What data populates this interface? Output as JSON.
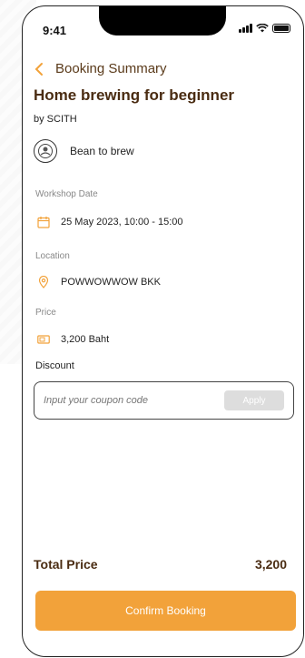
{
  "status_bar": {
    "time": "9:41"
  },
  "header": {
    "title": "Booking Summary"
  },
  "course": {
    "title": "Home brewing for beginner",
    "by": "by SCITH"
  },
  "organizer": {
    "name": "Bean to brew"
  },
  "workshop_date": {
    "label": "Workshop Date",
    "value": "25 May 2023, 10:00 - 15:00"
  },
  "location": {
    "label": "Location",
    "value": "POWWOWWOW BKK"
  },
  "price": {
    "label": "Price",
    "value": "3,200 Baht"
  },
  "discount": {
    "label": "Discount",
    "placeholder": "Input your coupon code",
    "apply_label": "Apply"
  },
  "total": {
    "label": "Total Price",
    "value": "3,200"
  },
  "confirm": {
    "label": "Confirm Booking"
  },
  "colors": {
    "accent": "#f2a23a",
    "title": "#4a2c12"
  }
}
